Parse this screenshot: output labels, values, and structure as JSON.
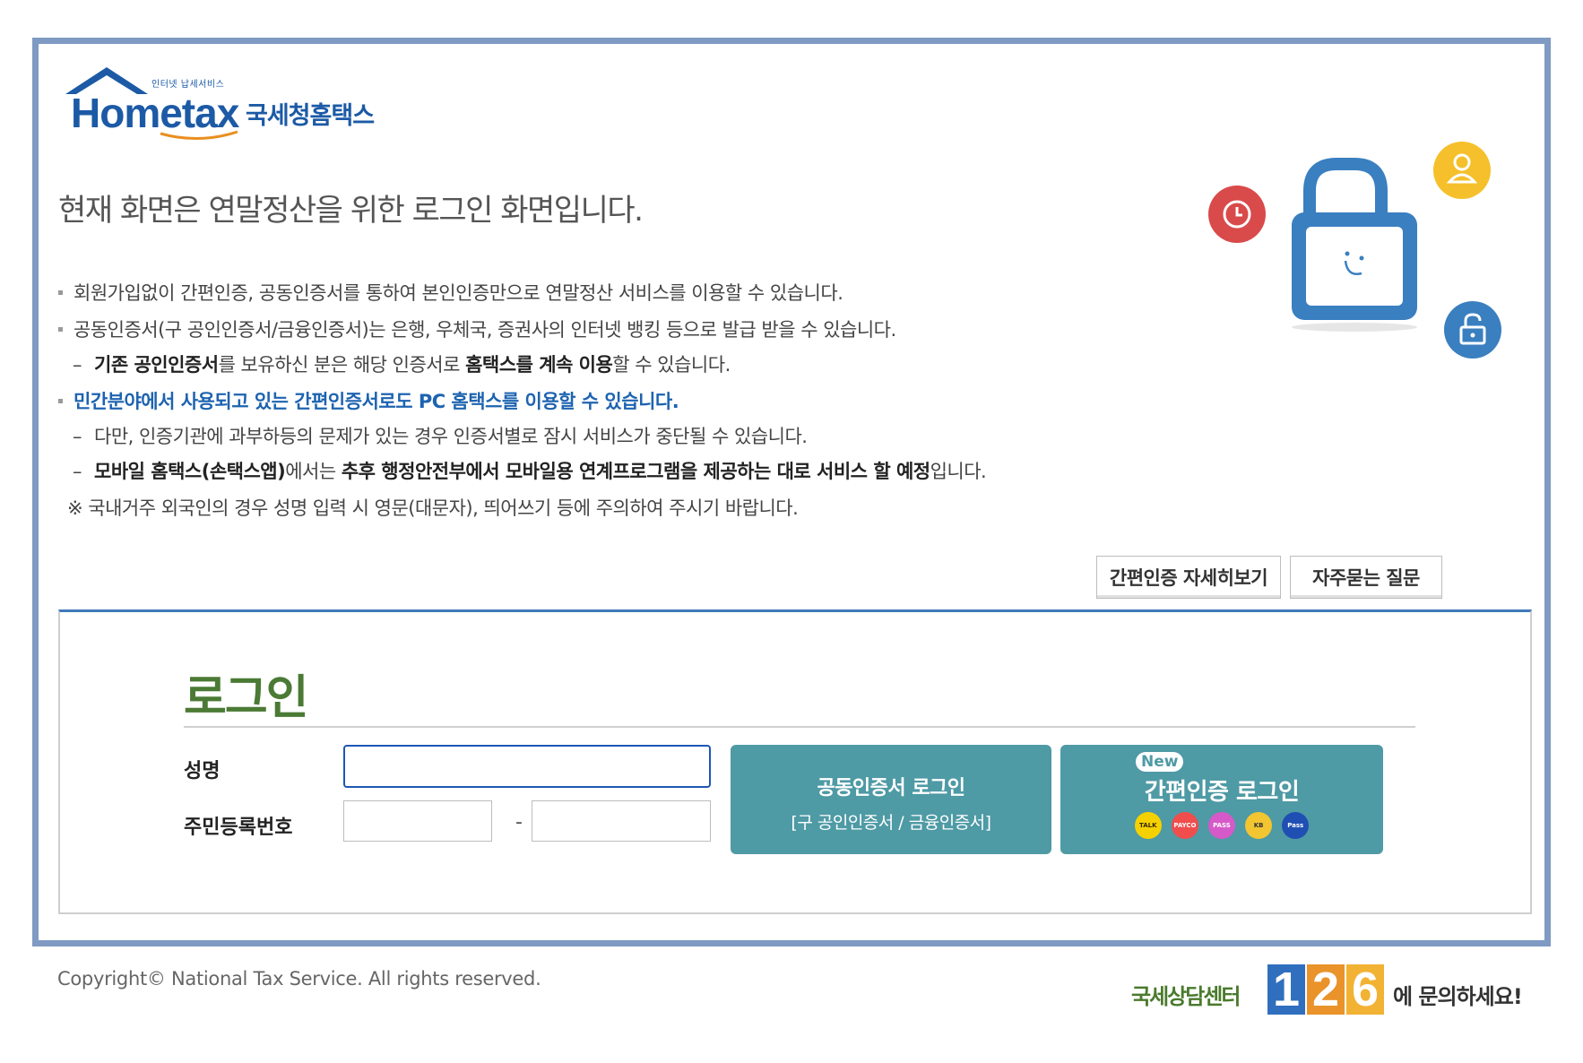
{
  "header": {
    "logo_en": "Hometax",
    "logo_small": "인터넷 납세서비스",
    "logo_kr": "국세청홈택스",
    "headline": "현재 화면은 연말정산을 위한 로그인 화면입니다."
  },
  "notes": {
    "line1": "회원가입없이 간편인증, 공동인증서를 통하여 본인인증만으로 연말정산 서비스를 이용할 수 있습니다.",
    "line2": "공동인증서(구 공인인증서/금융인증서)는 은행, 우체국, 증권사의 인터넷 뱅킹 등으로 발급 받을 수 있습니다.",
    "line3_dash": "–",
    "line3_b1": "기존 공인인증서",
    "line3_t1": "를 보유하신 분은 해당 인증서로 ",
    "line3_b2": "홈택스를 계속 이용",
    "line3_t2": "할 수 있습니다.",
    "line4": "민간분야에서 사용되고 있는 간편인증서로도 PC 홈택스를 이용할 수 있습니다.",
    "line5": "다만, 인증기관에 과부하등의 문제가 있는 경우 인증서별로 잠시 서비스가 중단될 수 있습니다.",
    "line6_b1": "모바일 홈택스(손택스앱)",
    "line6_t1": "에서는 ",
    "line6_b2": "추후 행정안전부에서 모바일용 연계프로그램을 제공하는 대로 서비스 할 예정",
    "line6_t2": "입니다.",
    "line7": "※ 국내거주 외국인의 경우 성명 입력 시 영문(대문자), 띄어쓰기 등에 주의하여 주시기 바랍니다."
  },
  "help_buttons": {
    "simple_auth_detail": "간편인증 자세히보기",
    "faq": "자주묻는 질문"
  },
  "login": {
    "title": "로그인",
    "name_label": "성명",
    "name_value": "",
    "rrn_label": "주민등록번호",
    "rrn_sep": "-",
    "rrn_front_value": "",
    "rrn_back_value": "",
    "cert_button_line1": "공동인증서 로그인",
    "cert_button_line2": "[구 공인인증서 / 금융인증서]",
    "simple_button_badge": "New",
    "simple_button_label": "간편인증 로그인",
    "provider_icons": [
      "kakao-talk",
      "payco",
      "pass",
      "kb",
      "samsung-pass"
    ],
    "provider_labels": [
      "TALK",
      "PAYCO",
      "PASS",
      "KB",
      "Pass"
    ]
  },
  "footer": {
    "copyright": "Copyright© National Tax Service. All rights reserved.",
    "callcenter_text": "국세상담센터",
    "callcenter_digits": [
      "1",
      "2",
      "6"
    ],
    "callcenter_ask": "에 문의하세요!"
  },
  "colors": {
    "frame_border": "#7f9ac3",
    "brand_blue": "#1c5aa6",
    "login_green": "#4b7a35",
    "teal_button": "#4e9aa5",
    "notice_blue": "#1d63b0"
  }
}
